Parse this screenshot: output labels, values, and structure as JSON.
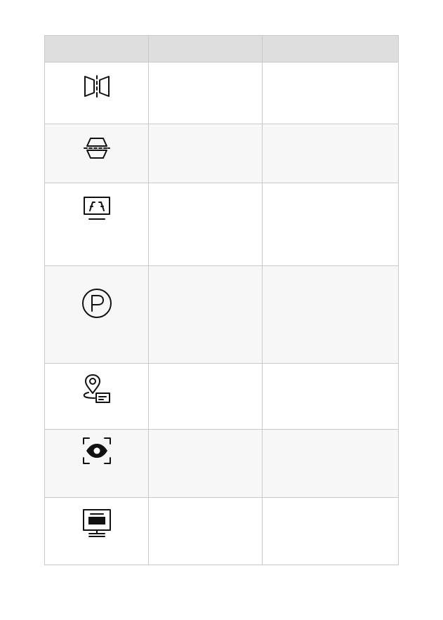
{
  "table": {
    "headers": [
      "",
      "",
      ""
    ],
    "rows": [
      {
        "icon": "mirror-fold-icon",
        "name": "",
        "description": ""
      },
      {
        "icon": "split-trapezoid-icon",
        "name": "",
        "description": ""
      },
      {
        "icon": "lane-display-icon",
        "name": "",
        "description": ""
      },
      {
        "icon": "parking-p-icon",
        "name": "",
        "description": ""
      },
      {
        "icon": "location-message-icon",
        "name": "",
        "description": ""
      },
      {
        "icon": "eye-scan-icon",
        "name": "",
        "description": ""
      },
      {
        "icon": "screen-display-icon",
        "name": "",
        "description": ""
      }
    ]
  }
}
